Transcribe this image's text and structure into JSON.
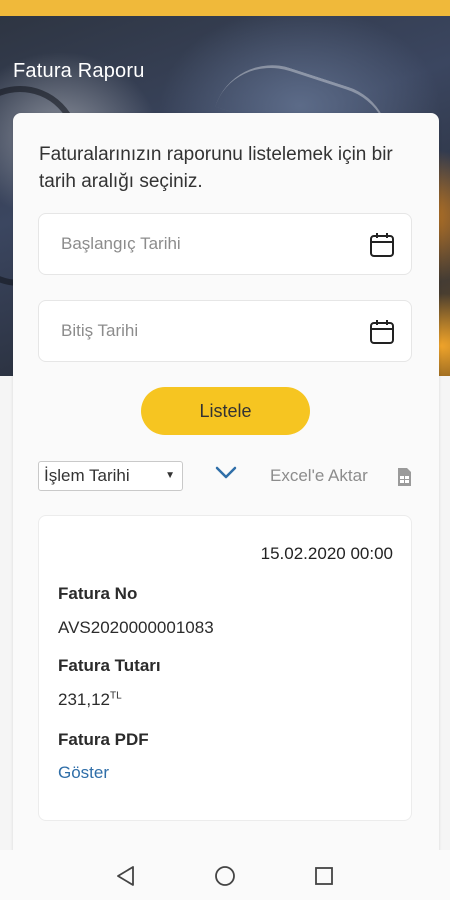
{
  "header": {
    "title": "Fatura Raporu"
  },
  "form": {
    "intro": "Faturalarınızın raporunu listelemek için bir tarih aralığı seçiniz.",
    "start_placeholder": "Başlangıç Tarihi",
    "end_placeholder": "Bitiş Tarihi",
    "submit_label": "Listele"
  },
  "toolbar": {
    "sort_selected": "İşlem Tarihi",
    "export_label": "Excel'e Aktar"
  },
  "invoice": {
    "date": "15.02.2020 00:00",
    "number_label": "Fatura No",
    "number_value": "AVS2020000001083",
    "amount_label": "Fatura Tutarı",
    "amount_value": "231,12",
    "amount_currency": "TL",
    "pdf_label": "Fatura PDF",
    "pdf_link": "Göster"
  },
  "icons": [
    "calendar-icon",
    "chevron-down-icon",
    "excel-file-icon",
    "back-icon",
    "home-icon",
    "recents-icon"
  ],
  "colors": {
    "accent": "#f6c521",
    "link": "#2f6ea8",
    "status_strip": "#f0b93a"
  }
}
